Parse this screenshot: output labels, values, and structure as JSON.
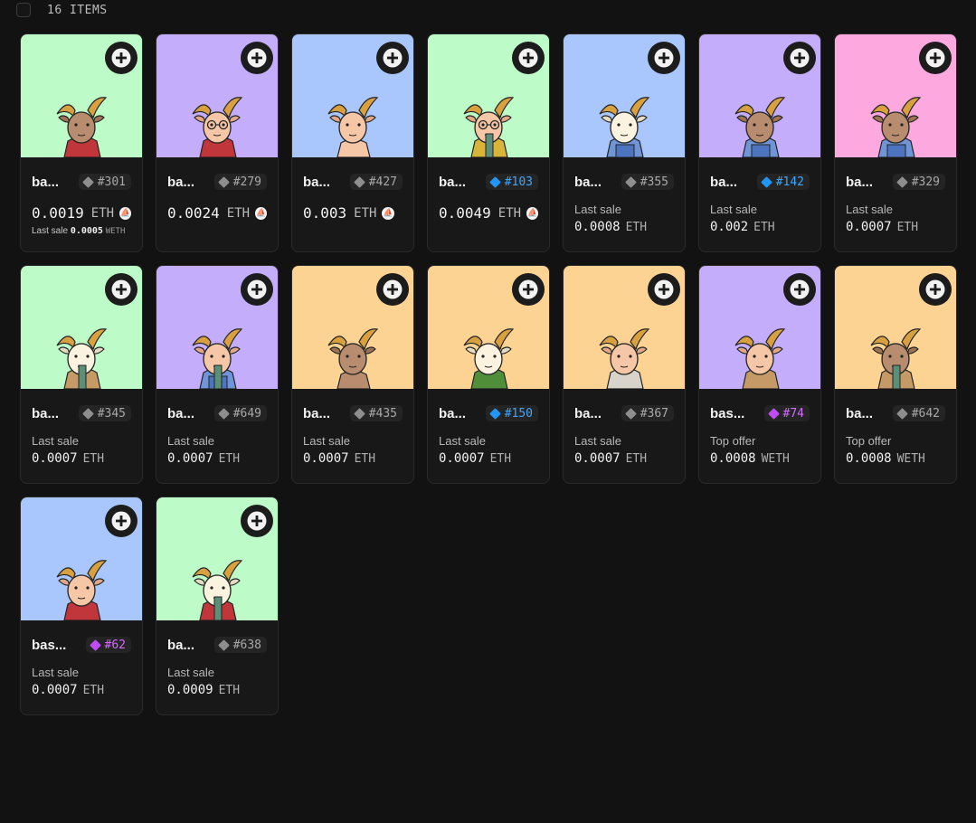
{
  "header": {
    "item_count_label": "16 ITEMS"
  },
  "colors": {
    "green": "#bdfcc9",
    "purple": "#c4aefc",
    "blue": "#a9c6fd",
    "pink": "#fda9e0",
    "orange": "#fdd394",
    "diamond_gray": "#8e8e8e",
    "diamond_blue": "#2196f3",
    "diamond_purple": "#c04cf3"
  },
  "items": [
    {
      "name": "ba...",
      "token": "#301",
      "rarity": "gray",
      "bg": "green",
      "skin": "brown",
      "shirt": "red",
      "mode": "listed",
      "price": "0.0019",
      "currency": "ETH",
      "last_label": "Last sale",
      "last_value": "0.0005",
      "last_currency": "WETH"
    },
    {
      "name": "ba...",
      "token": "#279",
      "rarity": "gray",
      "bg": "purple",
      "skin": "peach",
      "shirt": "red",
      "glasses": true,
      "mode": "listed",
      "price": "0.0024",
      "currency": "ETH"
    },
    {
      "name": "ba...",
      "token": "#427",
      "rarity": "gray",
      "bg": "blue",
      "skin": "peach",
      "shirt": "none",
      "mode": "listed",
      "price": "0.003",
      "currency": "ETH"
    },
    {
      "name": "ba...",
      "token": "#103",
      "rarity": "blue",
      "bg": "green",
      "skin": "peach",
      "shirt": "yellow",
      "glasses": true,
      "cig": true,
      "mode": "listed",
      "price": "0.0049",
      "currency": "ETH"
    },
    {
      "name": "ba...",
      "token": "#355",
      "rarity": "gray",
      "bg": "blue",
      "skin": "cream",
      "shirt": "overalls",
      "mode": "sale",
      "label": "Last sale",
      "price": "0.0008",
      "currency": "ETH"
    },
    {
      "name": "ba...",
      "token": "#142",
      "rarity": "blue",
      "bg": "purple",
      "skin": "brown",
      "shirt": "overalls",
      "mode": "sale",
      "label": "Last sale",
      "price": "0.002",
      "currency": "ETH"
    },
    {
      "name": "ba...",
      "token": "#329",
      "rarity": "gray",
      "bg": "pink",
      "skin": "brown",
      "shirt": "overalls",
      "mode": "sale",
      "label": "Last sale",
      "price": "0.0007",
      "currency": "ETH"
    },
    {
      "name": "ba...",
      "token": "#345",
      "rarity": "gray",
      "bg": "green",
      "skin": "cream",
      "shirt": "fur",
      "cig": true,
      "mode": "sale",
      "label": "Last sale",
      "price": "0.0007",
      "currency": "ETH"
    },
    {
      "name": "ba...",
      "token": "#649",
      "rarity": "gray",
      "bg": "purple",
      "skin": "peach",
      "shirt": "overalls",
      "cig": true,
      "mode": "sale",
      "label": "Last sale",
      "price": "0.0007",
      "currency": "ETH"
    },
    {
      "name": "ba...",
      "token": "#435",
      "rarity": "gray",
      "bg": "orange",
      "skin": "brown",
      "shirt": "none",
      "mode": "sale",
      "label": "Last sale",
      "price": "0.0007",
      "currency": "ETH"
    },
    {
      "name": "ba...",
      "token": "#150",
      "rarity": "blue",
      "bg": "orange",
      "skin": "cream",
      "shirt": "green",
      "mode": "sale",
      "label": "Last sale",
      "price": "0.0007",
      "currency": "ETH"
    },
    {
      "name": "ba...",
      "token": "#367",
      "rarity": "gray",
      "bg": "orange",
      "skin": "peach",
      "shirt": "jacket",
      "mode": "sale",
      "label": "Last sale",
      "price": "0.0007",
      "currency": "ETH"
    },
    {
      "name": "bas...",
      "token": "#74",
      "rarity": "purple",
      "bg": "purple",
      "skin": "peach",
      "shirt": "fur",
      "mode": "sale",
      "label": "Top offer",
      "price": "0.0008",
      "currency": "WETH"
    },
    {
      "name": "ba...",
      "token": "#642",
      "rarity": "gray",
      "bg": "orange",
      "skin": "brown",
      "shirt": "fur",
      "cig": true,
      "mode": "sale",
      "label": "Top offer",
      "price": "0.0008",
      "currency": "WETH"
    },
    {
      "name": "bas...",
      "token": "#62",
      "rarity": "purple",
      "bg": "blue",
      "skin": "peach",
      "shirt": "red",
      "mode": "sale",
      "label": "Last sale",
      "price": "0.0007",
      "currency": "ETH"
    },
    {
      "name": "ba...",
      "token": "#638",
      "rarity": "gray",
      "bg": "green",
      "skin": "cream",
      "shirt": "red",
      "cig": true,
      "mode": "sale",
      "label": "Last sale",
      "price": "0.0009",
      "currency": "ETH"
    }
  ]
}
